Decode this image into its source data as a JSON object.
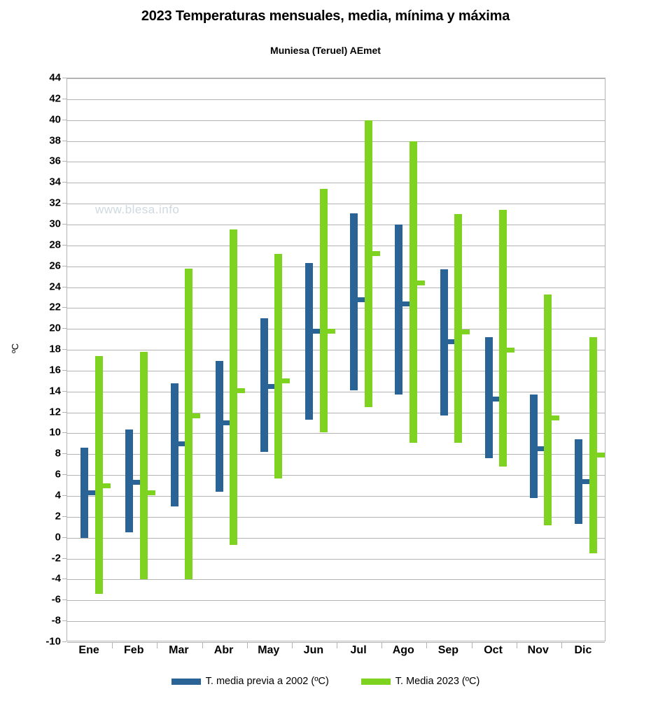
{
  "chart_data": {
    "type": "bar",
    "title": "2023 Temperaturas mensuales, media, mínima y máxima",
    "subtitle": "Muniesa (Teruel) AEmet",
    "xlabel": "",
    "ylabel": "ºC",
    "ylim": [
      -10,
      44
    ],
    "ytick_step": 2,
    "grid": true,
    "legend_position": "bottom",
    "watermark": "www.blesa.info",
    "categories": [
      "Ene",
      "Feb",
      "Mar",
      "Abr",
      "May",
      "Jun",
      "Jul",
      "Ago",
      "Sep",
      "Oct",
      "Nov",
      "Dic"
    ],
    "yticks": [
      44,
      42,
      40,
      38,
      36,
      34,
      32,
      30,
      28,
      26,
      24,
      22,
      20,
      18,
      16,
      14,
      12,
      10,
      8,
      6,
      4,
      2,
      0,
      -2,
      -4,
      -6,
      -8,
      -10
    ],
    "series": [
      {
        "name": "T. media previa a 2002 (ºC)",
        "color": "#2a6496",
        "min": [
          0.0,
          0.55,
          3.0,
          4.4,
          8.2,
          11.3,
          14.1,
          13.7,
          11.7,
          7.65,
          3.8,
          1.35
        ],
        "max": [
          8.6,
          10.4,
          14.8,
          16.9,
          21.0,
          26.3,
          31.1,
          30.0,
          25.7,
          19.2,
          13.7,
          9.45
        ],
        "mean": [
          4.3,
          5.3,
          9.0,
          11.0,
          14.5,
          19.8,
          22.8,
          22.4,
          18.8,
          13.3,
          8.5,
          5.4
        ]
      },
      {
        "name": "T. Media 2023  (ºC)",
        "color": "#7ed321",
        "min": [
          -5.4,
          -4.0,
          -4.0,
          -0.7,
          5.7,
          10.1,
          12.5,
          9.1,
          9.1,
          6.8,
          1.2,
          -1.5
        ],
        "max": [
          17.4,
          17.8,
          25.8,
          29.5,
          27.2,
          33.4,
          40.0,
          38.0,
          31.0,
          31.4,
          23.3,
          19.2
        ],
        "mean": [
          5.0,
          4.3,
          11.7,
          14.1,
          15.0,
          19.8,
          27.2,
          24.4,
          19.7,
          18.0,
          11.5,
          7.9
        ]
      }
    ]
  },
  "legend": {
    "items": [
      {
        "label": "T. media previa a 2002 (ºC)",
        "color": "#2a6496"
      },
      {
        "label": "T. Media 2023  (ºC)",
        "color": "#7ed321"
      }
    ]
  }
}
